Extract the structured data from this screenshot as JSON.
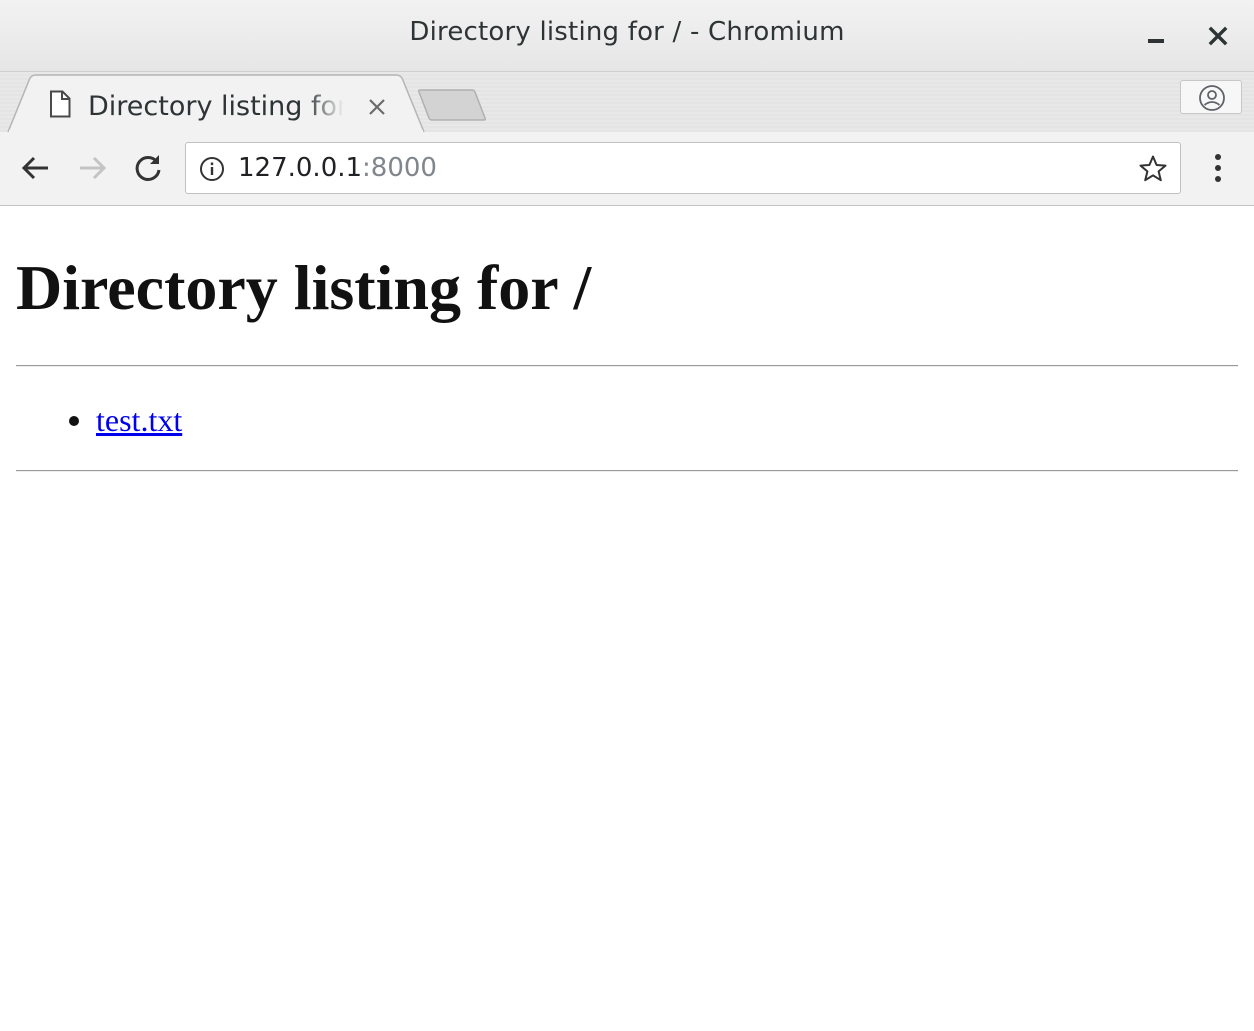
{
  "window": {
    "title": "Directory listing for / - Chromium"
  },
  "tab": {
    "title": "Directory listing for /"
  },
  "toolbar": {
    "url_host": "127.0.0.1",
    "url_port": ":8000"
  },
  "page": {
    "heading": "Directory listing for /",
    "files": [
      {
        "name": "test.txt"
      }
    ]
  },
  "icons": {
    "back": "arrow-left-icon",
    "forward": "arrow-right-icon",
    "reload": "reload-icon",
    "info": "info-icon",
    "bookmark": "star-icon",
    "menu": "three-dots-vertical-icon",
    "profile": "person-icon",
    "favicon": "document-icon",
    "tab_close": "close-icon"
  },
  "colors": {
    "link": "#0000ee",
    "forward_disabled": "#c4c4c4",
    "port": "#80868b"
  }
}
